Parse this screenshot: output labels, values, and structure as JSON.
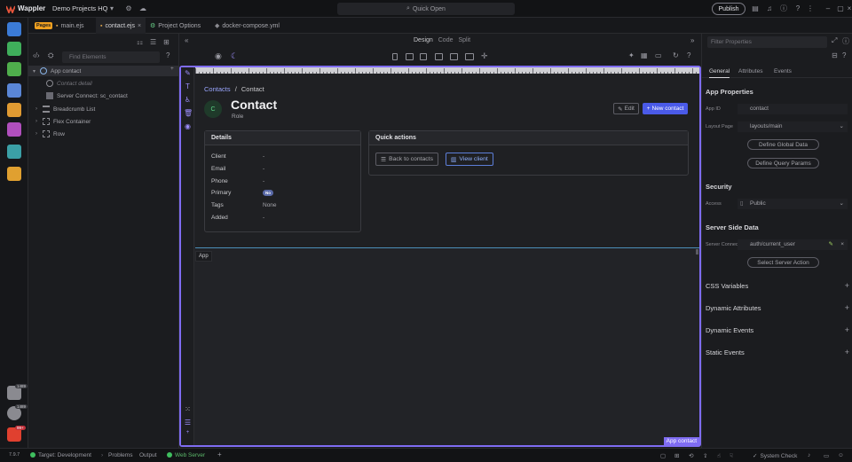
{
  "titlebar": {
    "app_name": "Wappler",
    "project": "Demo Projects HQ",
    "quick_open": "Quick Open",
    "publish_label": "Publish"
  },
  "tabs": {
    "pages_badge": "Pages",
    "items": [
      "main.ejs",
      "contact.ejs",
      "Project Options",
      "docker-compose.yml"
    ],
    "close_glyph": "×"
  },
  "tree": {
    "search_placeholder": "Find Elements",
    "items": [
      "App contact",
      "Contact detail",
      "Server Connect: sc_contact",
      "Breadcrumb List",
      "Flex Container",
      "Row"
    ]
  },
  "toolbar": {
    "design": "Design",
    "code": "Code",
    "split": "Split"
  },
  "canvas": {
    "breadcrumb_link": "Contacts",
    "breadcrumb_sep": "/",
    "breadcrumb_current": "Contact",
    "avatar_initial": "C",
    "title": "Contact",
    "role": "Role",
    "edit_label": "Edit",
    "new_label": "New contact",
    "details_title": "Details",
    "details": [
      {
        "label": "Client",
        "value": "-"
      },
      {
        "label": "Email",
        "value": "-"
      },
      {
        "label": "Phone",
        "value": "-"
      },
      {
        "label": "Primary",
        "value": "No"
      },
      {
        "label": "Tags",
        "value": "None"
      },
      {
        "label": "Added",
        "value": "-"
      }
    ],
    "quick_title": "Quick actions",
    "back_label": "Back to contacts",
    "view_label": "View client",
    "app_label": "App",
    "app_contact": "App contact"
  },
  "props": {
    "filter_placeholder": "Filter Properties",
    "tab_general": "General",
    "tab_attributes": "Attributes",
    "tab_events": "Events",
    "app_properties": "App Properties",
    "app_id_label": "App ID",
    "app_id_value": "contact",
    "layout_label": "Layout Page",
    "layout_value": "layouts/main",
    "define_global": "Define Global Data",
    "define_query": "Define Query Params",
    "security": "Security",
    "access_label": "Access",
    "access_value": "Public",
    "server_side": "Server Side Data",
    "sc_label": "Server Connect",
    "sc_value": "auth/current_user",
    "select_action": "Select Server Action",
    "css_vars": "CSS Variables",
    "dyn_attrs": "Dynamic Attributes",
    "dyn_events": "Dynamic Events",
    "static_events": "Static Events"
  },
  "status": {
    "version": "7.9.7",
    "target": "Target: Development",
    "problems": "Problems",
    "output": "Output",
    "web_server": "Web Server",
    "system_check": "System Check"
  },
  "badges": {
    "b1": "1489",
    "b2": "1489",
    "b3": "99+"
  },
  "colors": {
    "accent": "#7f6cf2",
    "primary_button": "#4a5ae8",
    "status_green": "#3fbf5f"
  }
}
